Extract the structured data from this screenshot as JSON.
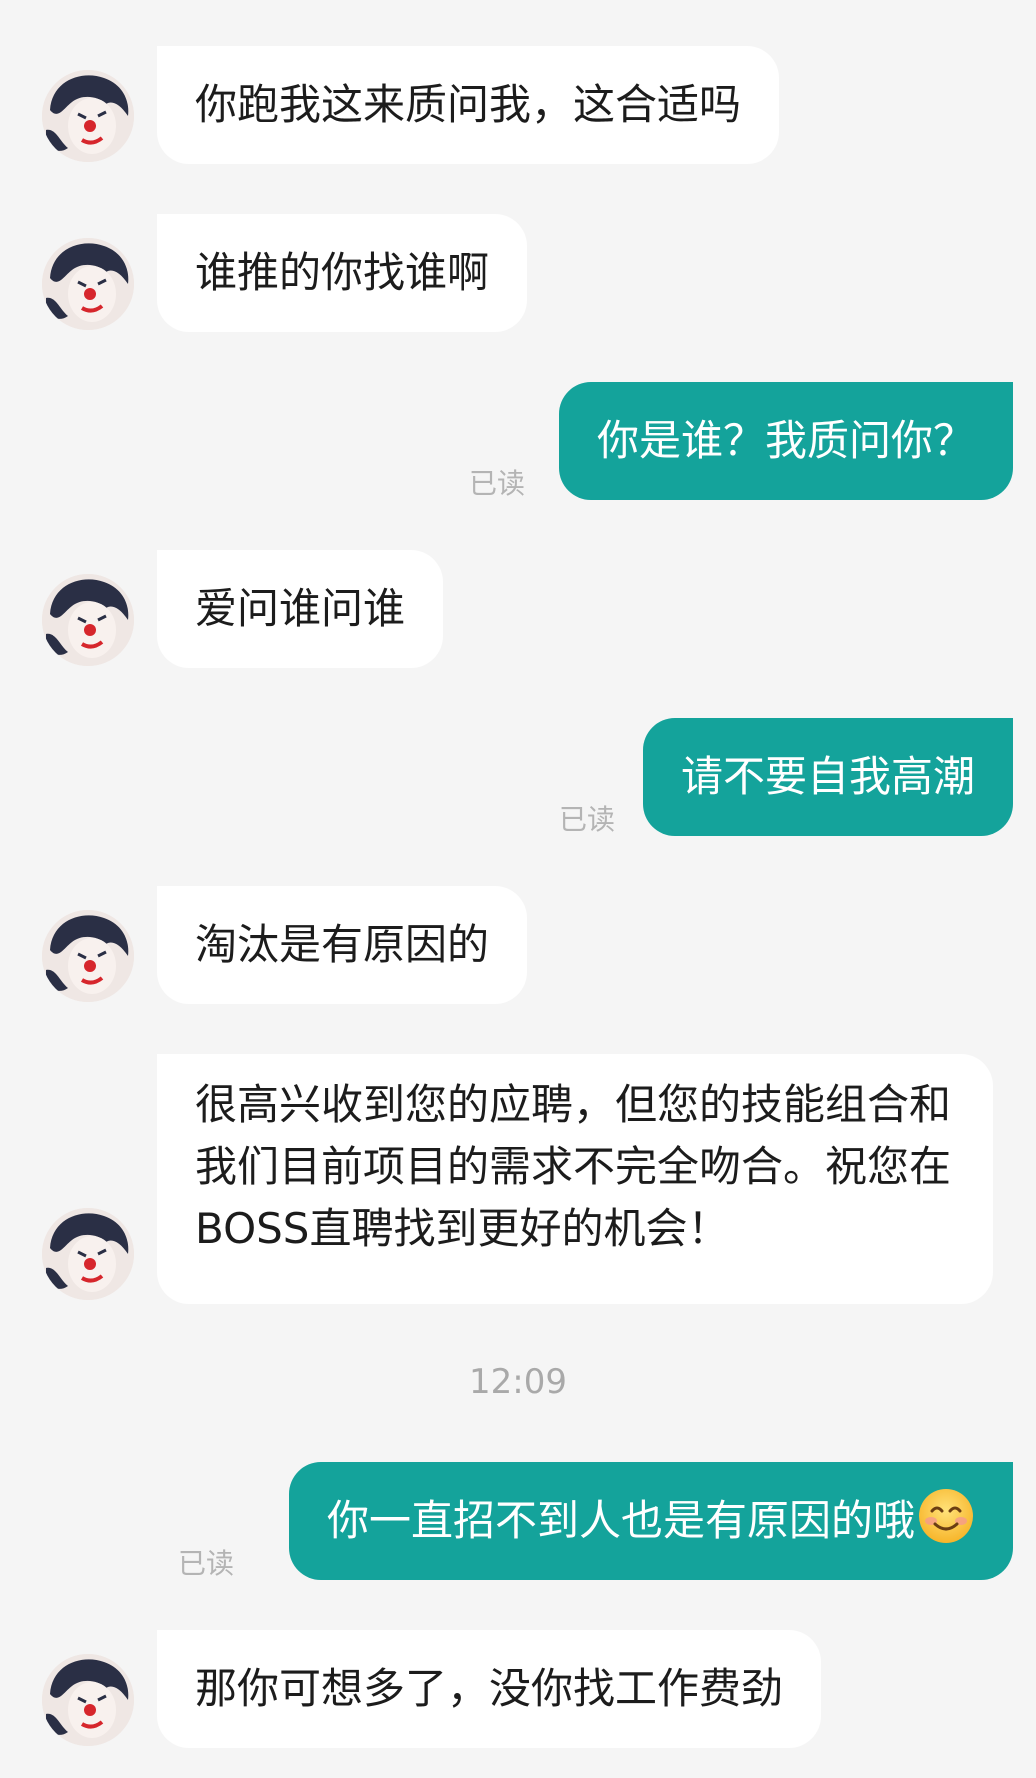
{
  "messages": [
    {
      "side": "in",
      "text": "你跑我这来质问我，这合适吗"
    },
    {
      "side": "in",
      "text": "谁推的你找谁啊"
    },
    {
      "side": "out",
      "text": "你是谁？我质问你？",
      "status": "已读"
    },
    {
      "side": "in",
      "text": "爱问谁问谁"
    },
    {
      "side": "out",
      "text": "请不要自我高潮",
      "status": "已读"
    },
    {
      "side": "in",
      "text": "淘汰是有原因的"
    },
    {
      "side": "in",
      "text": "很高兴收到您的应聘，但您的技能组合和我们目前项目的需求不完全吻合。祝您在BOSS直聘找到更好的机会！"
    },
    {
      "side": "out",
      "text": "你一直招不到人也是有原因的哦",
      "emoji": "smiling-face-emoji",
      "status": "已读"
    },
    {
      "side": "in",
      "text": "那你可想多了，没你找工作费劲"
    }
  ],
  "timestamp": "12:09",
  "colors": {
    "background": "#f5f5f5",
    "incoming_bubble": "#ffffff",
    "outgoing_bubble": "#14a39b",
    "read_status": "#b4b4b4"
  }
}
